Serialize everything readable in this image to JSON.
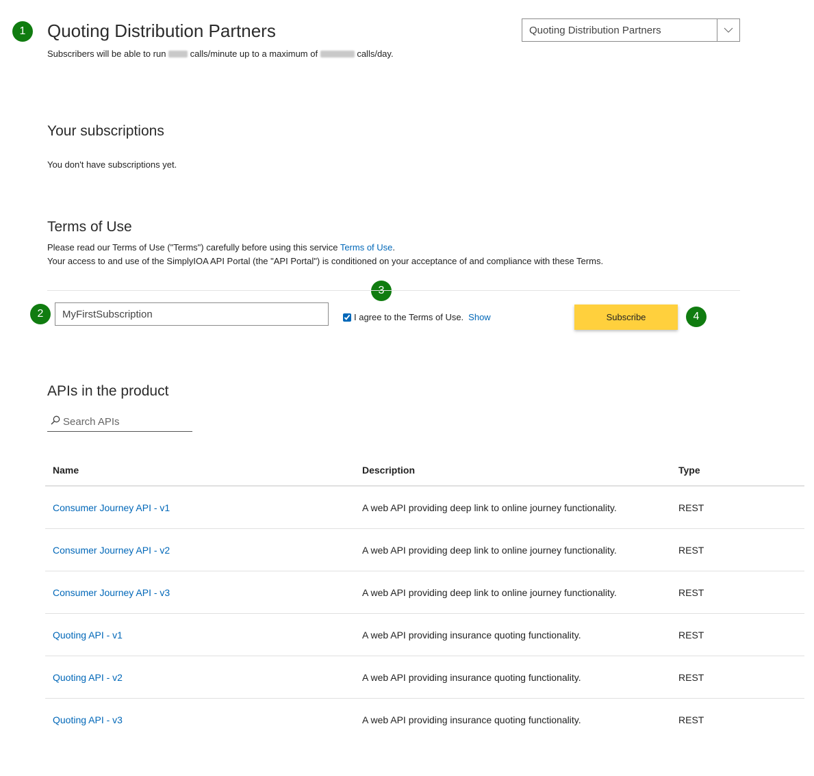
{
  "steps": [
    "1",
    "2",
    "3",
    "4"
  ],
  "product": {
    "title": "Quoting Distribution Partners",
    "rate_prefix": "Subscribers will be able to run",
    "rate_middle": "calls/minute up to a maximum of",
    "rate_suffix": "calls/day.",
    "selector_value": "Quoting Distribution Partners"
  },
  "subscriptions": {
    "heading": "Your subscriptions",
    "empty_text": "You don't have subscriptions yet."
  },
  "terms": {
    "heading": "Terms of Use",
    "line1_prefix": "Please read our Terms of Use (\"Terms\") carefully before using this service",
    "line1_link": "Terms of Use",
    "line1_suffix": ".",
    "line2": "Your access to and use of the SimplyIOA API Portal (the \"API Portal\") is conditioned on your acceptance of and compliance with these Terms."
  },
  "subscribe_form": {
    "name_value": "MyFirstSubscription",
    "agree_label": "I agree to the Terms of Use.",
    "agree_checked": true,
    "show_link": "Show",
    "subscribe_label": "Subscribe"
  },
  "apis": {
    "heading": "APIs in the product",
    "search_placeholder": "Search APIs",
    "columns": [
      "Name",
      "Description",
      "Type"
    ],
    "rows": [
      {
        "name": "Consumer Journey API - v1",
        "description": "A web API providing deep link to online journey functionality.",
        "type": "REST"
      },
      {
        "name": "Consumer Journey API - v2",
        "description": "A web API providing deep link to online journey functionality.",
        "type": "REST"
      },
      {
        "name": "Consumer Journey API - v3",
        "description": "A web API providing deep link to online journey functionality.",
        "type": "REST"
      },
      {
        "name": "Quoting API - v1",
        "description": "A web API providing insurance quoting functionality.",
        "type": "REST"
      },
      {
        "name": "Quoting API - v2",
        "description": "A web API providing insurance quoting functionality.",
        "type": "REST"
      },
      {
        "name": "Quoting API - v3",
        "description": "A web API providing insurance quoting functionality.",
        "type": "REST"
      }
    ]
  },
  "colors": {
    "badge": "#107c10",
    "link": "#0067b8",
    "subscribe_button": "#ffd03d"
  }
}
